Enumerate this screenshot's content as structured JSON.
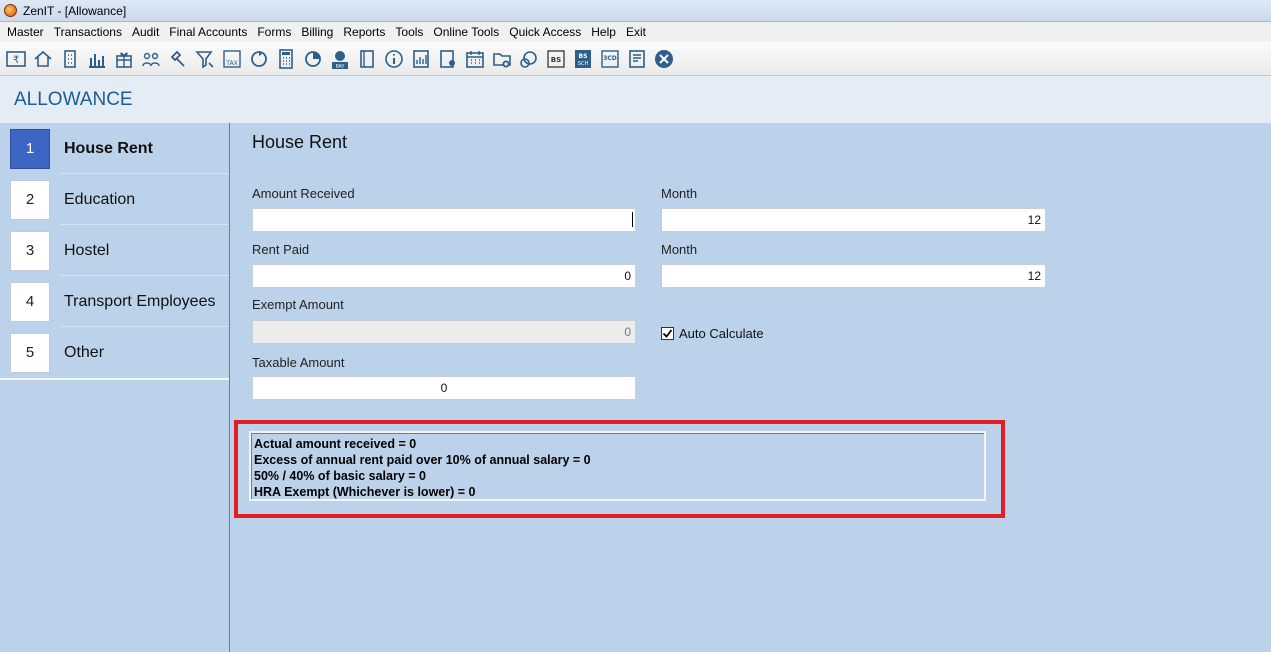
{
  "window": {
    "title": "ZenIT - [Allowance]"
  },
  "menu": [
    "Master",
    "Transactions",
    "Audit",
    "Final Accounts",
    "Forms",
    "Billing",
    "Reports",
    "Tools",
    "Online Tools",
    "Quick Access",
    "Help",
    "Exit"
  ],
  "toolbar": {
    "icons": [
      "rupee-icon",
      "home-icon",
      "building-icon",
      "bar-chart-icon",
      "gift-icon",
      "users-icon",
      "gavel-icon",
      "filter-icon",
      "tax-icon",
      "refresh-icon",
      "calculator-icon",
      "pie-chart-icon",
      "epay-icon",
      "book-icon",
      "info-icon",
      "report-icon",
      "person-edit-icon",
      "calendar-icon",
      "folder-add-icon",
      "sync-icon",
      "bs-icon",
      "bs-sch-icon",
      "3cd-icon",
      "document-icon",
      "close-icon"
    ],
    "text": {
      "tax": "TAX",
      "pay": "PAY",
      "bs": "BS",
      "sch": "SCH",
      "three_cd": "3CD"
    }
  },
  "header": {
    "title": "ALLOWANCE"
  },
  "sidebar": {
    "items": [
      {
        "num": "1",
        "label": "House Rent",
        "active": true
      },
      {
        "num": "2",
        "label": "Education",
        "active": false
      },
      {
        "num": "3",
        "label": "Hostel",
        "active": false
      },
      {
        "num": "4",
        "label": "Transport Employees",
        "active": false
      },
      {
        "num": "5",
        "label": "Other",
        "active": false
      }
    ]
  },
  "form": {
    "title": "House Rent",
    "amount_received": {
      "label": "Amount Received",
      "value": ""
    },
    "month_1": {
      "label": "Month",
      "value": "12"
    },
    "rent_paid": {
      "label": "Rent Paid",
      "value": "0"
    },
    "month_2": {
      "label": "Month",
      "value": "12"
    },
    "exempt_amount": {
      "label": "Exempt Amount",
      "value": "0"
    },
    "auto_calculate": {
      "label": "Auto Calculate",
      "checked": true
    },
    "taxable_amount": {
      "label": "Taxable Amount",
      "value": "0"
    }
  },
  "calculation": {
    "lines": [
      "Actual amount received  = 0",
      "Excess of annual rent paid over 10% of annual salary = 0",
      "50% / 40% of basic salary = 0",
      "HRA Exempt (Whichever is lower)  = 0"
    ]
  },
  "colors": {
    "accent": "#3d65c4",
    "header_text": "#1f5b94",
    "highlight": "#e41d25",
    "background": "#bcd2ea"
  }
}
